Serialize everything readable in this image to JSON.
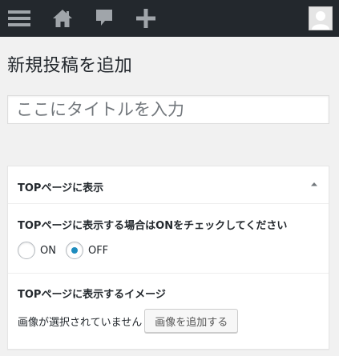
{
  "admin_bar": {
    "icons": [
      "menu-icon",
      "home-icon",
      "comment-icon",
      "plus-icon",
      "user-avatar"
    ],
    "background": "#23282d",
    "icon_color": "#a0a5aa"
  },
  "page": {
    "title": "新規投稿を追加"
  },
  "title_field": {
    "placeholder": "ここにタイトルを入力",
    "value": ""
  },
  "meta_box": {
    "title": "TOPページに表示",
    "toggle_icon": "triangle-up-icon",
    "display_question": "TOPページに表示する場合はONをチェックしてください",
    "options": [
      {
        "label": "ON",
        "checked": false
      },
      {
        "label": "OFF",
        "checked": true
      }
    ],
    "image_label": "TOPページに表示するイメージ",
    "image_status": "画像が選択されていません",
    "add_image_button": "画像を追加する",
    "accent_color": "#1e8cbe"
  }
}
